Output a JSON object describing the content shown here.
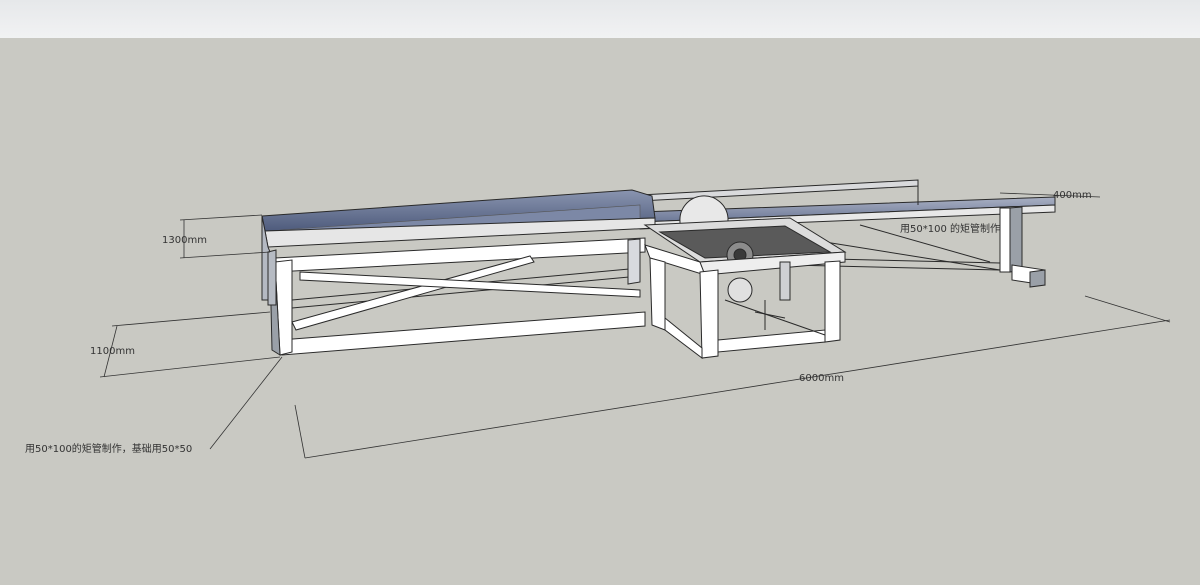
{
  "dimensions": {
    "depth_label": "1300mm",
    "height_label": "1100mm",
    "length_label": "6000mm",
    "extension_width_label": "400mm"
  },
  "annotations": {
    "main_note": "用50*100的矩管制作，基础用50*50",
    "extension_note": "用50*100 的矩管制作"
  },
  "colors": {
    "sky": "#eceeef",
    "ground": "#c9c9c3",
    "frame_face": "#ffffff",
    "frame_shadow": "#a8adb5",
    "table_top": "#5d6b8c",
    "edge": "#2a2a2a"
  }
}
